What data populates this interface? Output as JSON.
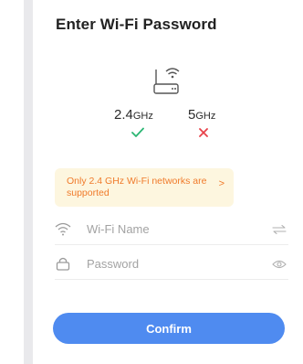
{
  "page": {
    "title": "Enter Wi-Fi Password"
  },
  "bands": {
    "band_24": {
      "value": "2.4",
      "unit": "GHz",
      "supported": true
    },
    "band_5": {
      "value": "5",
      "unit": "GHz",
      "supported": false
    }
  },
  "notice": {
    "text": "Only 2.4 GHz Wi-Fi networks are supported",
    "arrow": ">"
  },
  "wifi_field": {
    "placeholder": "Wi-Fi Name",
    "icon": "wifi-icon",
    "action_icon": "switch-icon"
  },
  "password_field": {
    "placeholder": "Password",
    "icon": "lock-icon",
    "action_icon": "eye-icon"
  },
  "confirm_button": {
    "label": "Confirm"
  },
  "colors": {
    "accent": "#4f8bf0",
    "success": "#2bb673",
    "error": "#e8424a",
    "notice_bg": "#fdf6df",
    "notice_text": "#f07a2a"
  }
}
